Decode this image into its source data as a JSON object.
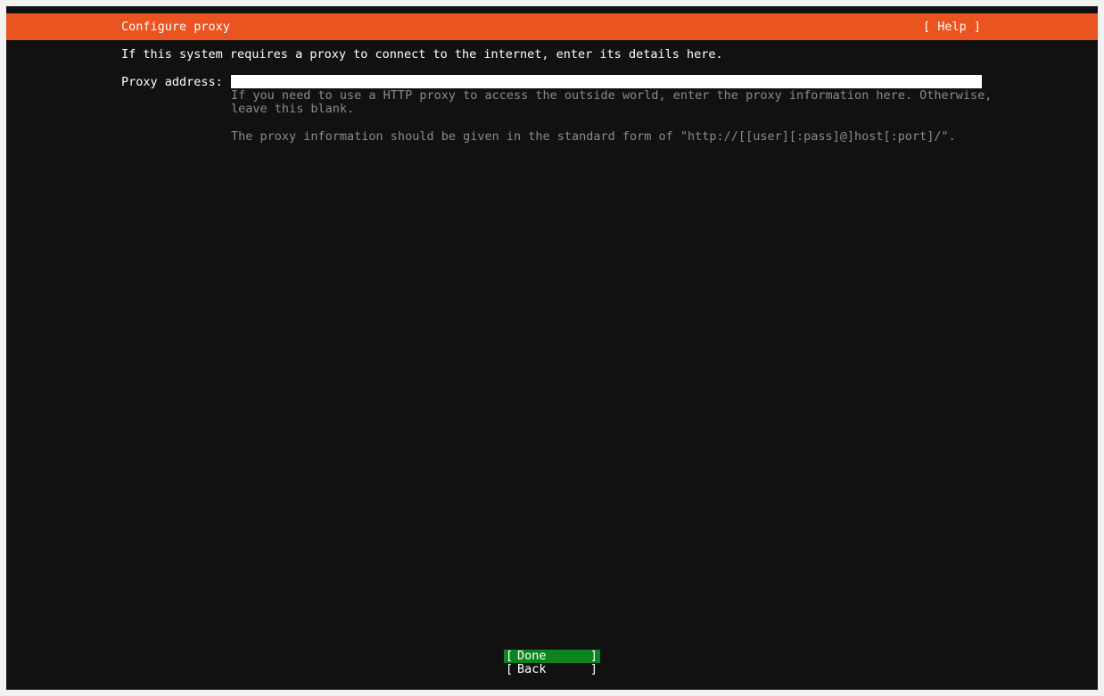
{
  "header": {
    "title": "Configure proxy",
    "help_label": "[ Help ]"
  },
  "intro": "If this system requires a proxy to connect to the internet, enter its details here.",
  "proxy_field": {
    "label": "Proxy address:",
    "value": "",
    "help_line1": "If you need to use a HTTP proxy to access the outside world, enter the proxy information here. Otherwise,",
    "help_line2": "leave this blank.",
    "help_line3": "The proxy information should be given in the standard form of \"http://[[user][:pass]@]host[:port]/\"."
  },
  "buttons": {
    "bracket_open": "[",
    "bracket_close": "]",
    "done": "Done",
    "back": "Back"
  },
  "colors": {
    "header_bg": "#e95420",
    "focus_bg": "#0e8420",
    "screen_bg": "#111111"
  }
}
